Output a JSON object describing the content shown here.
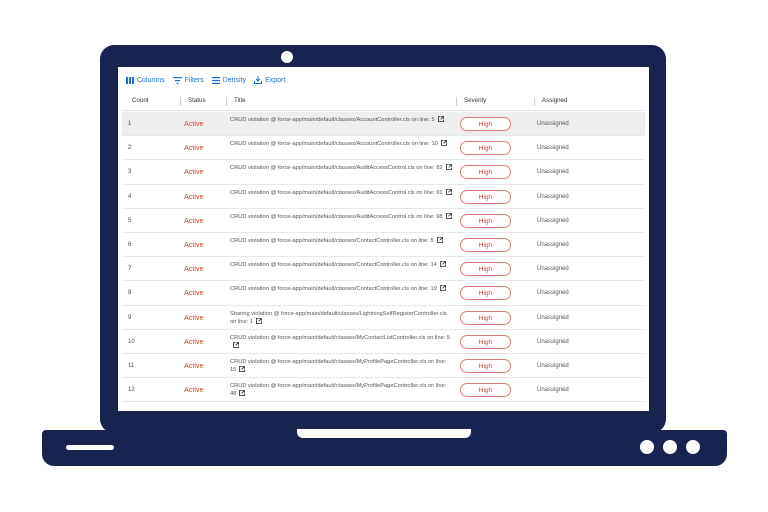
{
  "toolbar": {
    "columns_label": "Columns",
    "filters_label": "Filters",
    "density_label": "Density",
    "export_label": "Export"
  },
  "table": {
    "headers": {
      "count": "Count",
      "status": "Status",
      "title": "Title",
      "severity": "Severity",
      "assigned": "Assigned"
    },
    "rows": [
      {
        "count": "1",
        "status": "Active",
        "title": "CRUD violation @ force-app/main/default/classes/AccountController.cls on line: 5",
        "severity": "High",
        "assigned": "Unassigned"
      },
      {
        "count": "2",
        "status": "Active",
        "title": "CRUD violation @ force-app/main/default/classes/AccountController.cls on line: 10",
        "severity": "High",
        "assigned": "Unassigned"
      },
      {
        "count": "3",
        "status": "Active",
        "title": "CRUD violation @ force-app/main/default/classes/AuditAccessControl.cls on line: 82",
        "severity": "High",
        "assigned": "Unassigned"
      },
      {
        "count": "4",
        "status": "Active",
        "title": "CRUD violation @ force-app/main/default/classes/AuditAccessControl.cls on line: 91",
        "severity": "High",
        "assigned": "Unassigned"
      },
      {
        "count": "5",
        "status": "Active",
        "title": "CRUD violation @ force-app/main/default/classes/AuditAccessControl.cls on line: 98",
        "severity": "High",
        "assigned": "Unassigned"
      },
      {
        "count": "6",
        "status": "Active",
        "title": "CRUD violation @ force-app/main/default/classes/ContactController.cls on line: 5",
        "severity": "High",
        "assigned": "Unassigned"
      },
      {
        "count": "7",
        "status": "Active",
        "title": "CRUD violation @ force-app/main/default/classes/ContactController.cls on line: 14",
        "severity": "High",
        "assigned": "Unassigned"
      },
      {
        "count": "8",
        "status": "Active",
        "title": "CRUD violation @ force-app/main/default/classes/ContactController.cls on line: 19",
        "severity": "High",
        "assigned": "Unassigned"
      },
      {
        "count": "9",
        "status": "Active",
        "title": "Sharing violation @ force-app/main/default/classes/LightningSelfRegisterController.cls on line: 1",
        "severity": "High",
        "assigned": "Unassigned"
      },
      {
        "count": "10",
        "status": "Active",
        "title": "CRUD violation @ force-app/main/default/classes/MyContactListController.cls on line: 5",
        "severity": "High",
        "assigned": "Unassigned"
      },
      {
        "count": "11",
        "status": "Active",
        "title": "CRUD violation @ force-app/main/default/classes/MyProfilePageController.cls on line: 15",
        "severity": "High",
        "assigned": "Unassigned"
      },
      {
        "count": "12",
        "status": "Active",
        "title": "CRUD violation @ force-app/main/default/classes/MyProfilePageController.cls on line: 48",
        "severity": "High",
        "assigned": "Unassigned"
      }
    ]
  },
  "colors": {
    "frame": "#18234f",
    "accent": "#1a6fd0",
    "status_active": "#d9442f",
    "severity_high": "#d43a3a"
  },
  "icons": {
    "columns": "columns-icon",
    "filters": "filter-icon",
    "density": "density-icon",
    "export": "export-icon",
    "external_link": "external-link-icon"
  }
}
